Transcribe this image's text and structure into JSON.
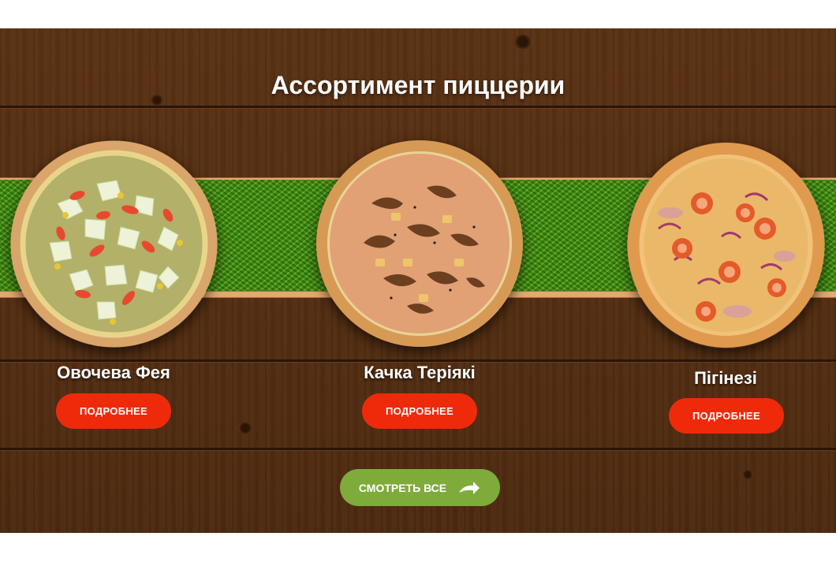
{
  "section": {
    "title": "Ассортимент пиццерии",
    "view_all_label": "СМОТРЕТЬ ВСЕ",
    "view_all_icon": "arrow-right-icon"
  },
  "products": [
    {
      "name": "Овочева Фея",
      "button": "ПОДРОБНЕЕ"
    },
    {
      "name": "Качка Теріякі",
      "button": "ПОДРОБНЕЕ"
    },
    {
      "name": "Пігінезі",
      "button": "ПОДРОБНЕЕ"
    }
  ],
  "colors": {
    "button_red": "#ee2a0b",
    "view_all_green": "#7eab3a",
    "wood_brown": "#4d2a10",
    "grass_green": "#3d8a12"
  }
}
